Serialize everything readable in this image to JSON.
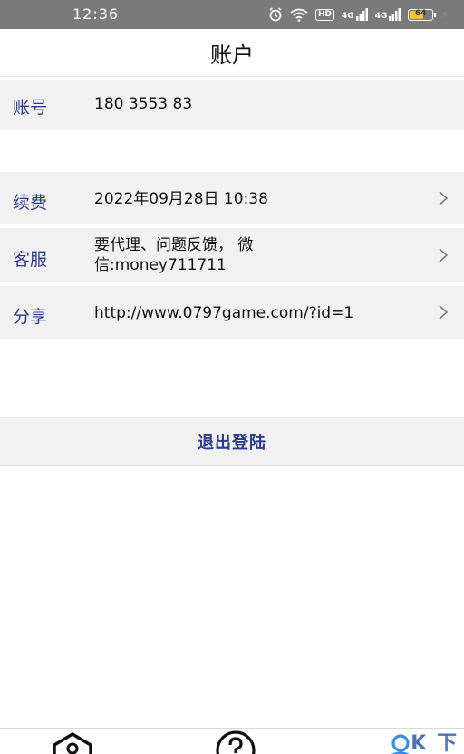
{
  "status_bar": {
    "time": "12:36",
    "hd_label": "HD",
    "signal1_label": "4G",
    "signal2_label": "4G",
    "battery_percent": 64
  },
  "header": {
    "title": "账户"
  },
  "account_row": {
    "label": "账号",
    "value": "180 3553 83"
  },
  "renew_row": {
    "label": "续费",
    "value": "2022年09月28日 10:38"
  },
  "service_row": {
    "label": "客服",
    "value": "要代理、问题反馈，  微信:money711711"
  },
  "share_row": {
    "label": "分享",
    "value": "http://www.0797game.com/?id=1"
  },
  "logout": {
    "label": "退出登陆"
  },
  "tabbar": {
    "tabs": [
      {
        "icon": "home-icon"
      },
      {
        "icon": "help-icon"
      },
      {
        "icon": "user-icon"
      }
    ]
  },
  "watermark": {
    "text": "K 下"
  },
  "colors": {
    "accent": "#2b3a8c",
    "row_bg": "#f1f1f1",
    "status_bg": "#7a7a7a",
    "tab_active": "#3a8ee6"
  }
}
